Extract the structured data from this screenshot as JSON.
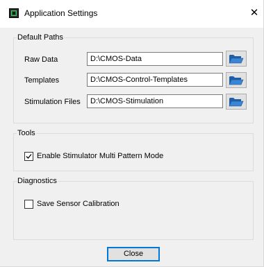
{
  "window": {
    "title": "Application Settings",
    "close_glyph": "✕",
    "icon": "app-chip-icon"
  },
  "default_paths": {
    "legend": "Default Paths",
    "rows": [
      {
        "label": "Raw Data",
        "value": "D:\\CMOS-Data",
        "button_icon": "folder-icon"
      },
      {
        "label": "Templates",
        "value": "D:\\CMOS-Control-Templates",
        "button_icon": "folder-icon"
      },
      {
        "label": "Stimulation Files",
        "value": "D:\\CMOS-Stimulation",
        "button_icon": "folder-icon"
      }
    ]
  },
  "tools": {
    "legend": "Tools",
    "checkbox_label": "Enable Stimulator Multi Pattern Mode",
    "checked": true
  },
  "diagnostics": {
    "legend": "Diagnostics",
    "checkbox_label": "Save Sensor Calibration",
    "checked": false
  },
  "footer": {
    "close_label": "Close"
  },
  "colors": {
    "dialog_bg": "#f0f0f0",
    "titlebar_bg": "#ffffff",
    "focus_border": "#0078d7",
    "folder_blue": "#1f5fa8"
  }
}
